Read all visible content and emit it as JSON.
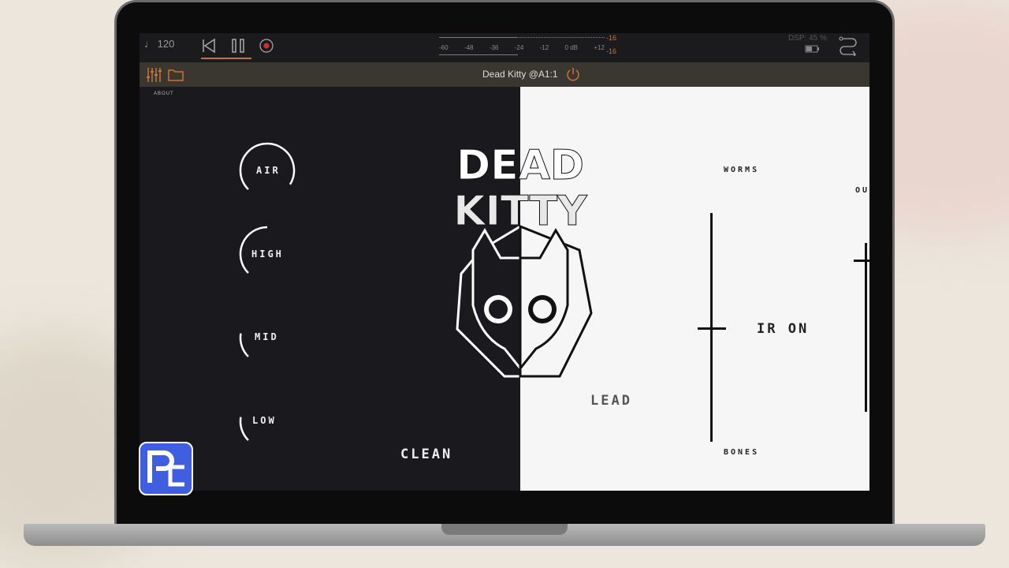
{
  "transport": {
    "tempo": "♩ 120",
    "meter_ticks": [
      "-60",
      "-48",
      "-36",
      "-24",
      "-12",
      "0 dB",
      "+12"
    ],
    "peak_top": "-16",
    "peak_bottom": "-16",
    "dsp": "DSP: 45 %"
  },
  "header": {
    "title": "Dead Kitty @A1:1"
  },
  "plugin": {
    "about": "ABOUT",
    "logo_text": [
      "DEAD",
      "KITTY"
    ],
    "knobs": [
      {
        "label": "AIR",
        "value": 0.95
      },
      {
        "label": "HIGH",
        "value": 0.5
      },
      {
        "label": "MID",
        "value": 0.2
      },
      {
        "label": "LOW",
        "value": 0.2
      }
    ],
    "clean": "CLEAN",
    "lead": "LEAD",
    "ir_slider": {
      "top": "WORMS",
      "bottom": "BONES",
      "value": 0.5
    },
    "ir_status": "IR ON",
    "out_slider": {
      "label": "OU",
      "value": 0.9
    }
  },
  "colors": {
    "accent": "#c8733a",
    "badge": "#3f5fe0"
  }
}
